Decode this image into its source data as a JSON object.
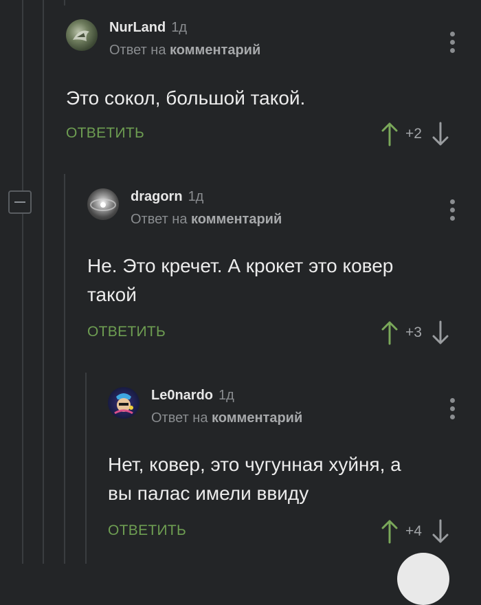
{
  "comments": [
    {
      "author": "NurLand",
      "time": "1д",
      "reply_prefix": "Ответ на",
      "reply_link": "комментарий",
      "text_lines": [
        "Это сокол, большой такой."
      ],
      "reply_label": "ОТВЕТИТЬ",
      "score": "+2"
    },
    {
      "author": "dragorn",
      "time": "1д",
      "reply_prefix": "Ответ на",
      "reply_link": "комментарий",
      "text_lines": [
        "Не. Это кречет. А крокет это ковер",
        "такой"
      ],
      "reply_label": "ОТВЕТИТЬ",
      "score": "+3"
    },
    {
      "author": "Le0nardo",
      "time": "1д",
      "reply_prefix": "Ответ на",
      "reply_link": "комментарий",
      "text_lines": [
        "Нет, ковер, это чугунная хуйня, а",
        "вы палас имели ввиду"
      ],
      "reply_label": "ОТВЕТИТЬ",
      "score": "+4"
    }
  ],
  "colors": {
    "background": "#232527",
    "reply_green": "#6e9e52",
    "upvote_green": "#7aa85a",
    "muted": "#8a8d90"
  },
  "icons": {
    "collapse": "minus-square-icon",
    "menu": "kebab-menu-icon",
    "upvote": "arrow-up-icon",
    "downvote": "arrow-down-icon"
  }
}
